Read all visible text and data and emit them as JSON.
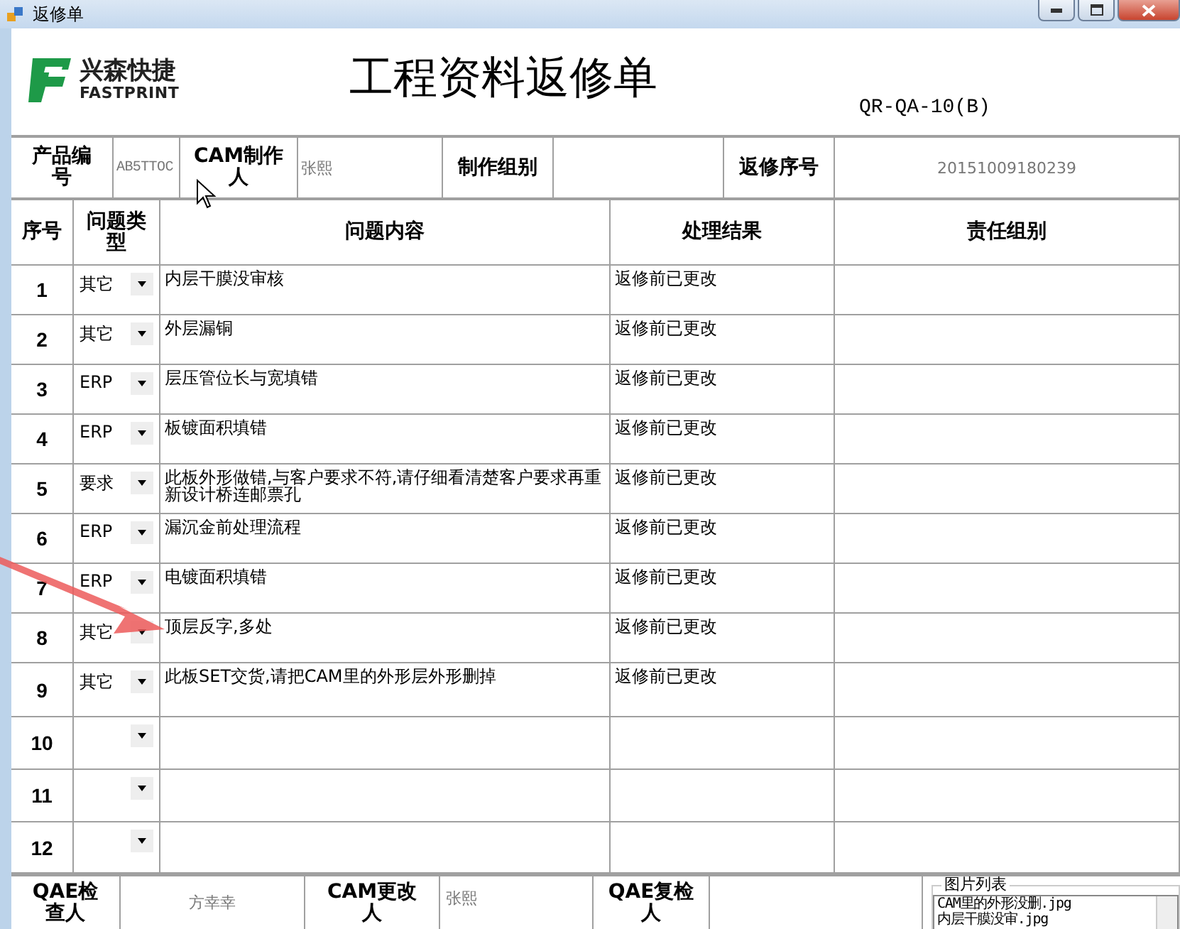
{
  "window": {
    "title": "返修单"
  },
  "header": {
    "logo_cn": "兴森快捷",
    "logo_en": "FASTPRINT",
    "title": "工程资料返修单",
    "code": "QR-QA-10(B)"
  },
  "info": [
    {
      "kind": "label",
      "text": "产品编号"
    },
    {
      "kind": "value",
      "text": "AB5TTOC"
    },
    {
      "kind": "label",
      "text": "CAM制作人"
    },
    {
      "kind": "value",
      "text": "张熙"
    },
    {
      "kind": "label",
      "text": "制作组别"
    },
    {
      "kind": "value"
    },
    {
      "kind": "label",
      "text": "返修序号"
    },
    {
      "kind": "value",
      "text": "20151009180239"
    }
  ],
  "table": {
    "columns": [
      "序号",
      "问题类型",
      "问题内容",
      "处理结果",
      "责任组别"
    ],
    "rows": [
      {
        "no": "1",
        "type": "其它",
        "content": "内层干膜没审核",
        "result": "返修前已更改"
      },
      {
        "no": "2",
        "type": "其它",
        "content": "外层漏铜",
        "result": "返修前已更改"
      },
      {
        "no": "3",
        "type": "ERP",
        "content": "层压管位长与宽填错",
        "result": "返修前已更改"
      },
      {
        "no": "4",
        "type": "ERP",
        "content": "板镀面积填错",
        "result": "返修前已更改"
      },
      {
        "no": "5",
        "type": "要求",
        "content": "此板外形做错,与客户要求不符,请仔细看清楚客户要求再重新设计桥连邮票孔",
        "result": "返修前已更改"
      },
      {
        "no": "6",
        "type": "ERP",
        "content": "漏沉金前处理流程",
        "result": "返修前已更改"
      },
      {
        "no": "7",
        "type": "ERP",
        "content": "电镀面积填错",
        "result": "返修前已更改"
      },
      {
        "no": "8",
        "type": "其它",
        "content": "顶层反字,多处",
        "result": "返修前已更改"
      },
      {
        "no": "9",
        "type": "其它",
        "content": "此板SET交货,请把CAM里的外形层外形删掉",
        "result": "返修前已更改"
      },
      {
        "no": "10"
      },
      {
        "no": "11"
      },
      {
        "no": "12"
      }
    ]
  },
  "footer": [
    {
      "kind": "label",
      "text": "QAE检查人"
    },
    {
      "kind": "value",
      "text": "方幸幸"
    },
    {
      "kind": "label",
      "text": "CAM更改人"
    },
    {
      "kind": "value",
      "text": "张熙"
    },
    {
      "kind": "label",
      "text": "QAE复检人"
    },
    {
      "kind": "value"
    }
  ],
  "image_list": {
    "title": "图片列表",
    "items": [
      "CAM里的外形没删.jpg",
      "内层干膜没审.jpg"
    ]
  }
}
